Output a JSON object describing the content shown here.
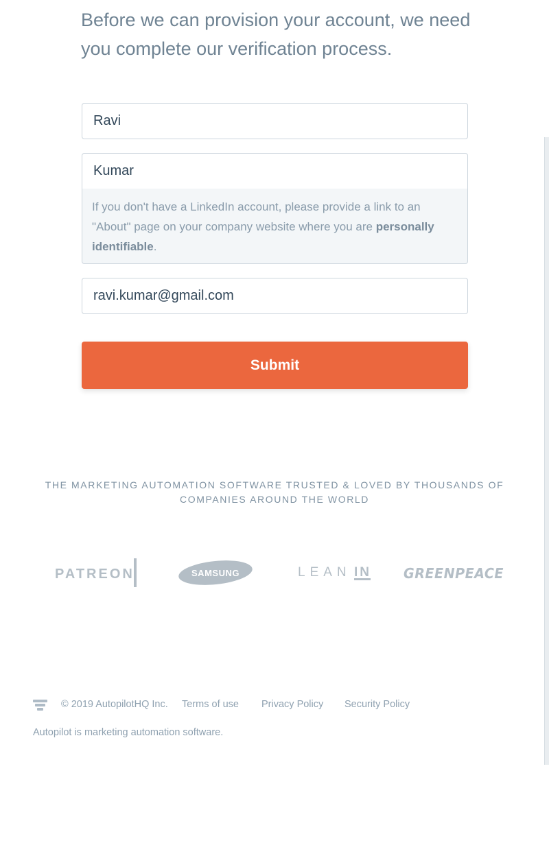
{
  "intro": {
    "text": "Before we can provision your account, we need you complete our verification process."
  },
  "form": {
    "first_name_value": "Ravi",
    "last_name_value": "Kumar",
    "hint_prefix": "If you don't have a LinkedIn account, please provide a link to an \"About\" page on your company website where you are ",
    "hint_bold": "personally identifiable",
    "hint_suffix": ".",
    "email_value": "ravi.kumar@gmail.com",
    "submit_label": "Submit"
  },
  "trusted": {
    "text": "THE MARKETING AUTOMATION SOFTWARE TRUSTED & LOVED BY THOUSANDS OF COMPANIES AROUND THE WORLD"
  },
  "logos": {
    "patreon": "PATREON",
    "samsung": "SAMSUNG",
    "leanin_a": "LEAN",
    "leanin_b": "IN",
    "greenpeace": "GREENPEACE"
  },
  "footer": {
    "copyright": "© 2019 AutopilotHQ Inc.",
    "terms": "Terms of use",
    "privacy": "Privacy Policy",
    "security": "Security Policy",
    "tagline": "Autopilot is marketing automation software."
  },
  "colors": {
    "accent": "#eb673e",
    "logo_gray": "#b4bec6"
  }
}
